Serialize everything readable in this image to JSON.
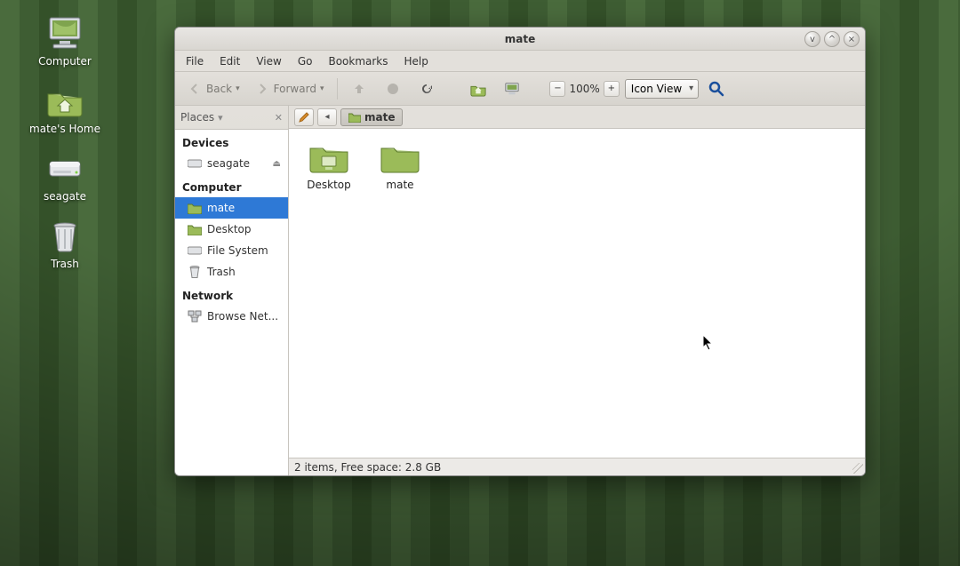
{
  "desktop_icons": [
    {
      "name": "computer",
      "label": "Computer"
    },
    {
      "name": "home",
      "label": "mate's Home"
    },
    {
      "name": "drive",
      "label": "seagate"
    },
    {
      "name": "trash",
      "label": "Trash"
    }
  ],
  "window": {
    "title": "mate",
    "menubar": [
      "File",
      "Edit",
      "View",
      "Go",
      "Bookmarks",
      "Help"
    ],
    "toolbar": {
      "back_label": "Back",
      "forward_label": "Forward",
      "zoom_text": "100%",
      "view_mode": "Icon View"
    },
    "side": {
      "title": "Places",
      "sections": {
        "devices": {
          "heading": "Devices",
          "items": [
            {
              "label": "seagate",
              "icon": "drive",
              "eject": true
            }
          ]
        },
        "computer": {
          "heading": "Computer",
          "items": [
            {
              "label": "mate",
              "icon": "home",
              "selected": true
            },
            {
              "label": "Desktop",
              "icon": "desktop"
            },
            {
              "label": "File System",
              "icon": "drive"
            },
            {
              "label": "Trash",
              "icon": "trash"
            }
          ]
        },
        "network": {
          "heading": "Network",
          "items": [
            {
              "label": "Browse Net...",
              "icon": "network"
            }
          ]
        }
      }
    },
    "path": {
      "crumb_label": "mate"
    },
    "files": [
      {
        "label": "Desktop",
        "icon": "folder-desktop"
      },
      {
        "label": "mate",
        "icon": "folder"
      }
    ],
    "statusbar": "2 items, Free space: 2.8 GB"
  }
}
